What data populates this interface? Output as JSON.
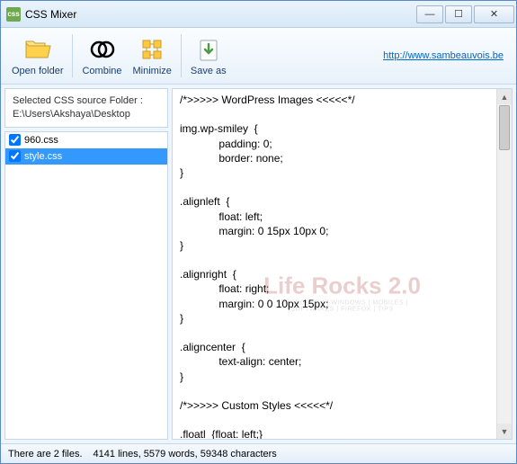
{
  "title": "CSS Mixer",
  "toolbar": {
    "open_folder": "Open folder",
    "combine": "Combine",
    "minimize": "Minimize",
    "save_as": "Save as",
    "link": "http://www.sambeauvois.be"
  },
  "folder": {
    "label": "Selected CSS source Folder :",
    "path": "E:\\Users\\Akshaya\\Desktop"
  },
  "files": [
    {
      "name": "960.css",
      "checked": true,
      "selected": false
    },
    {
      "name": "style.css",
      "checked": true,
      "selected": true
    }
  ],
  "code": "/*>>>>> WordPress Images <<<<<*/\n\nimg.wp-smiley  {\n             padding: 0;\n             border: none;\n}\n\n.alignleft  {\n             float: left;\n             margin: 0 15px 10px 0;\n}\n\n.alignright  {\n             float: right;\n             margin: 0 0 10px 15px;\n}\n\n.aligncenter  {\n             text-align: center;\n}\n\n/*>>>>> Custom Styles <<<<<*/\n\n.floatl  {float: left;}\n.floatr  {float: right;}\n\n.alignl  {text-align: left;}\n.alignr  {text-align: right;}\n.alignc  {text-align: center;}",
  "status": {
    "files": "There are 2 files.",
    "stats": "4141 lines, 5579 words, 59348 characters"
  },
  "watermark": {
    "big": "Life Rocks 2.0",
    "small": "TECHNOLOGY | WINDOWS | MOBILES | SOFTWARES | FIREFOX | TIPS"
  }
}
